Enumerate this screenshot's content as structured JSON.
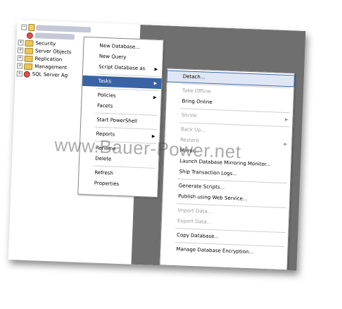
{
  "tree": {
    "items": [
      {
        "label": "Security"
      },
      {
        "label": "Server Objects"
      },
      {
        "label": "Replication"
      },
      {
        "label": "Management"
      },
      {
        "label": "SQL Server Ag"
      }
    ]
  },
  "context_menu": {
    "items": [
      {
        "label": "New Database..."
      },
      {
        "label": "New Query"
      },
      {
        "label": "Script Database as"
      },
      {
        "label": "Tasks"
      },
      {
        "label": "Policies"
      },
      {
        "label": "Facets"
      },
      {
        "label": "Start PowerShell"
      },
      {
        "label": "Reports"
      },
      {
        "label": "Rename"
      },
      {
        "label": "Delete"
      },
      {
        "label": "Refresh"
      },
      {
        "label": "Properties"
      }
    ]
  },
  "tasks_submenu": {
    "items": [
      {
        "label": "Detach..."
      },
      {
        "label": "Take Offline"
      },
      {
        "label": "Bring Online"
      },
      {
        "label": "Shrink"
      },
      {
        "label": "Back Up..."
      },
      {
        "label": "Restore"
      },
      {
        "label": "Mirror..."
      },
      {
        "label": "Launch Database Mirroring Monitor..."
      },
      {
        "label": "Ship Transaction Logs..."
      },
      {
        "label": "Generate Scripts..."
      },
      {
        "label": "Publish using Web Service..."
      },
      {
        "label": "Import Data..."
      },
      {
        "label": "Export Data..."
      },
      {
        "label": "Copy Database..."
      },
      {
        "label": "Manage Database Encryption..."
      }
    ]
  },
  "watermark": {
    "text": "www.Bauer-Power.net"
  },
  "colors": {
    "highlight": "#3a63a6",
    "desktop": "#6f6f6f",
    "disabled_text": "#9c9c9c"
  }
}
